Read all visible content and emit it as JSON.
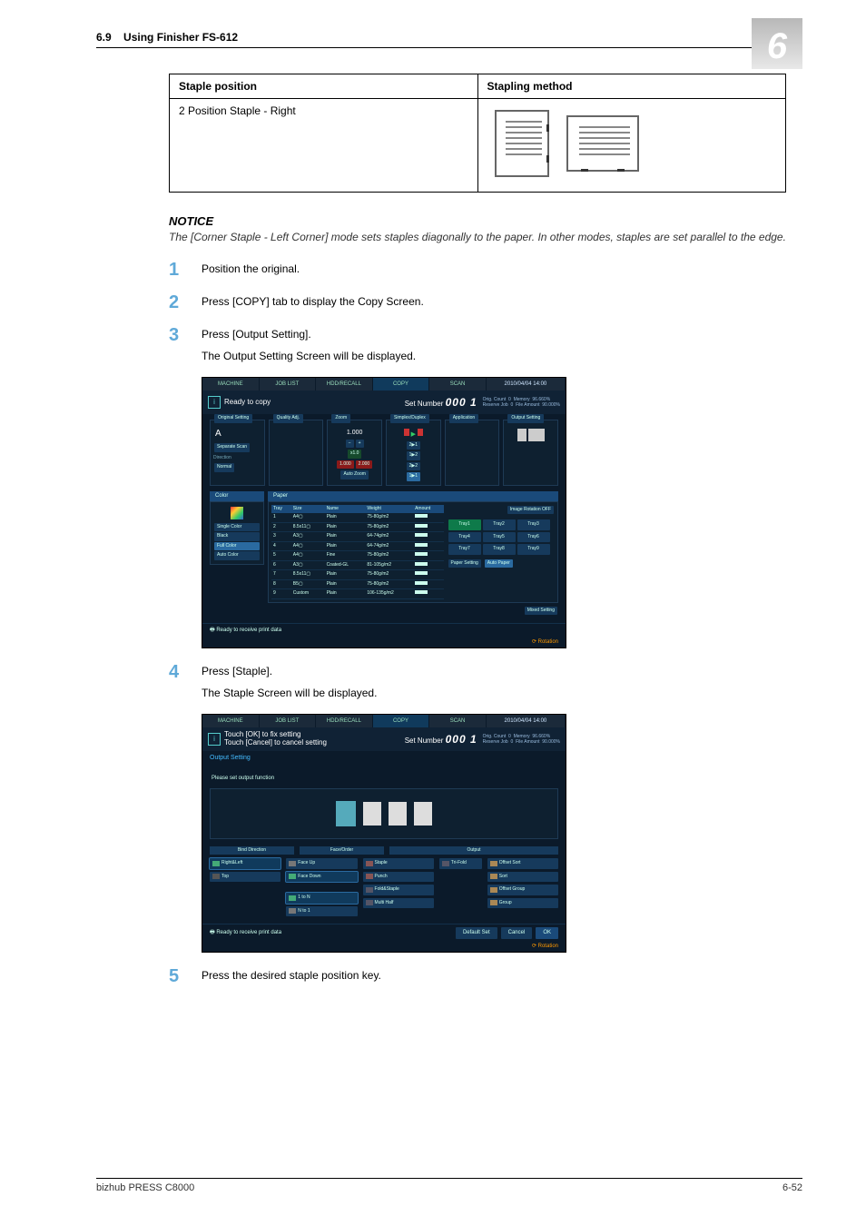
{
  "header": {
    "section_num": "6.9",
    "section_title": "Using Finisher FS-612",
    "chapter": "6"
  },
  "table": {
    "col1": "Staple position",
    "col2": "Stapling method",
    "row1_pos": "2 Position Staple - Right"
  },
  "notice": {
    "heading": "NOTICE",
    "text": "The [Corner Staple - Left Corner] mode sets staples diagonally to the paper. In other modes, staples are set parallel to the edge."
  },
  "steps": {
    "s1": {
      "num": "1",
      "text": "Position the original."
    },
    "s2": {
      "num": "2",
      "text": "Press [COPY] tab to display the Copy Screen."
    },
    "s3": {
      "num": "3",
      "text": "Press [Output Setting].",
      "sub": "The Output Setting Screen will be displayed."
    },
    "s4": {
      "num": "4",
      "text": "Press [Staple].",
      "sub": "The Staple Screen will be displayed."
    },
    "s5": {
      "num": "5",
      "text": "Press the desired staple position key."
    }
  },
  "screen1": {
    "tabs": {
      "machine": "MACHINE",
      "joblist": "JOB LIST",
      "hdd": "HDD/RECALL",
      "copy": "COPY",
      "scan": "SCAN",
      "datetime": "2010/04/04 14:00"
    },
    "status_msg": "Ready to copy",
    "set_number_label": "Set Number",
    "set_number_value": "000 1",
    "meta": {
      "orig_count_l": "Orig. Count",
      "orig_count_v": "0",
      "reserve_l": "Reserve Job",
      "reserve_v": "0",
      "memory_l": "Memory",
      "memory_v": "96.660%",
      "file_l": "File Amount",
      "file_v": "90.000%"
    },
    "panels": {
      "original": "Original Setting",
      "quality": "Quality Adj.",
      "zoom": "Zoom",
      "duplex": "Simplex/Duplex",
      "application": "Application",
      "output": "Output Setting"
    },
    "orig": {
      "separate": "Separate Scan",
      "direction": "Direction",
      "normal": "Normal"
    },
    "zoom": {
      "val": "1.000",
      "x1": "x1.0",
      "m1": "1.000",
      "m2": "2.000",
      "auto": "Auto Zoom"
    },
    "duplex": {
      "d11": "1▶1",
      "d12": "2▶1",
      "d21": "1▶2",
      "d22": "2▶2"
    },
    "color_section": "Color",
    "color_btns": {
      "single": "Single Color",
      "black": "Black",
      "full": "Full Color",
      "auto": "Auto Color"
    },
    "paper_section": "Paper",
    "paper_headers": {
      "tray": "Tray",
      "size": "Size",
      "name": "Name",
      "weight": "Weight",
      "amount": "Amount"
    },
    "paper_rows": [
      {
        "n": "1",
        "size": "A4▢",
        "name": "Plain",
        "weight": "75-80g/m2"
      },
      {
        "n": "2",
        "size": "8.5x11▢",
        "name": "Plain",
        "weight": "75-80g/m2"
      },
      {
        "n": "3",
        "size": "A3▢",
        "name": "Plain",
        "weight": "64-74g/m2"
      },
      {
        "n": "4",
        "size": "A4▢",
        "name": "Plain",
        "weight": "64-74g/m2"
      },
      {
        "n": "5",
        "size": "A4▢",
        "name": "Fine",
        "weight": "75-80g/m2"
      },
      {
        "n": "6",
        "size": "A3▢",
        "name": "Coated-GL",
        "weight": "81-105g/m2"
      },
      {
        "n": "7",
        "size": "8.5x11▢",
        "name": "Plain",
        "weight": "75-80g/m2"
      },
      {
        "n": "8",
        "size": "B5▢",
        "name": "Plain",
        "weight": "75-80g/m2"
      },
      {
        "n": "9",
        "size": "Custom",
        "name": "Plain",
        "weight": "106-135g/m2"
      }
    ],
    "imgrot": "Image Rotation OFF",
    "trays": {
      "t1": "Tray1",
      "t2": "Tray2",
      "t3": "Tray3",
      "t4": "Tray4",
      "t5": "Tray5",
      "t6": "Tray6",
      "t7": "Tray7",
      "t8": "Tray8",
      "t9": "Tray9"
    },
    "paper_setting": "Paper Setting",
    "auto_paper": "Auto Paper",
    "mixed": "Mixed Setting",
    "footer_status": "Ready to receive print data",
    "rotation": "Rotation"
  },
  "screen2": {
    "tabs": {
      "machine": "MACHINE",
      "joblist": "JOB LIST",
      "hdd": "HDD/RECALL",
      "copy": "COPY",
      "scan": "SCAN",
      "datetime": "2010/04/04 14:00"
    },
    "status_msg1": "Touch [OK] to fix setting",
    "status_msg2": "Touch [Cancel] to cancel setting",
    "set_number_label": "Set Number",
    "set_number_value": "000 1",
    "meta": {
      "orig_count_l": "Orig. Count",
      "orig_count_v": "0",
      "reserve_l": "Reserve Job",
      "reserve_v": "0",
      "memory_l": "Memory",
      "memory_v": "96.660%",
      "file_l": "File Amount",
      "file_v": "90.000%"
    },
    "breadcrumb": "Output Setting",
    "instruction": "Please set output function",
    "group_labels": {
      "bind": "Bind Direction",
      "face": "Face/Order",
      "output": "Output"
    },
    "bind": {
      "rl": "Right&Left",
      "top": "Top"
    },
    "face": {
      "up": "Face Up",
      "down": "Face Down",
      "1n": "1 to N",
      "n1": "N to 1"
    },
    "center": {
      "staple": "Staple",
      "punch": "Punch",
      "fold": "Fold&Staple",
      "multi": "Multi Half",
      "trifold": "Tri-Fold"
    },
    "output": {
      "offsort": "Offset Sort",
      "sort": "Sort",
      "offgroup": "Offset Group",
      "group": "Group"
    },
    "buttons": {
      "default": "Default Set",
      "cancel": "Cancel",
      "ok": "OK"
    },
    "footer_status": "Ready to receive print data",
    "rotation": "Rotation"
  },
  "footer": {
    "model": "bizhub PRESS C8000",
    "page": "6-52"
  }
}
